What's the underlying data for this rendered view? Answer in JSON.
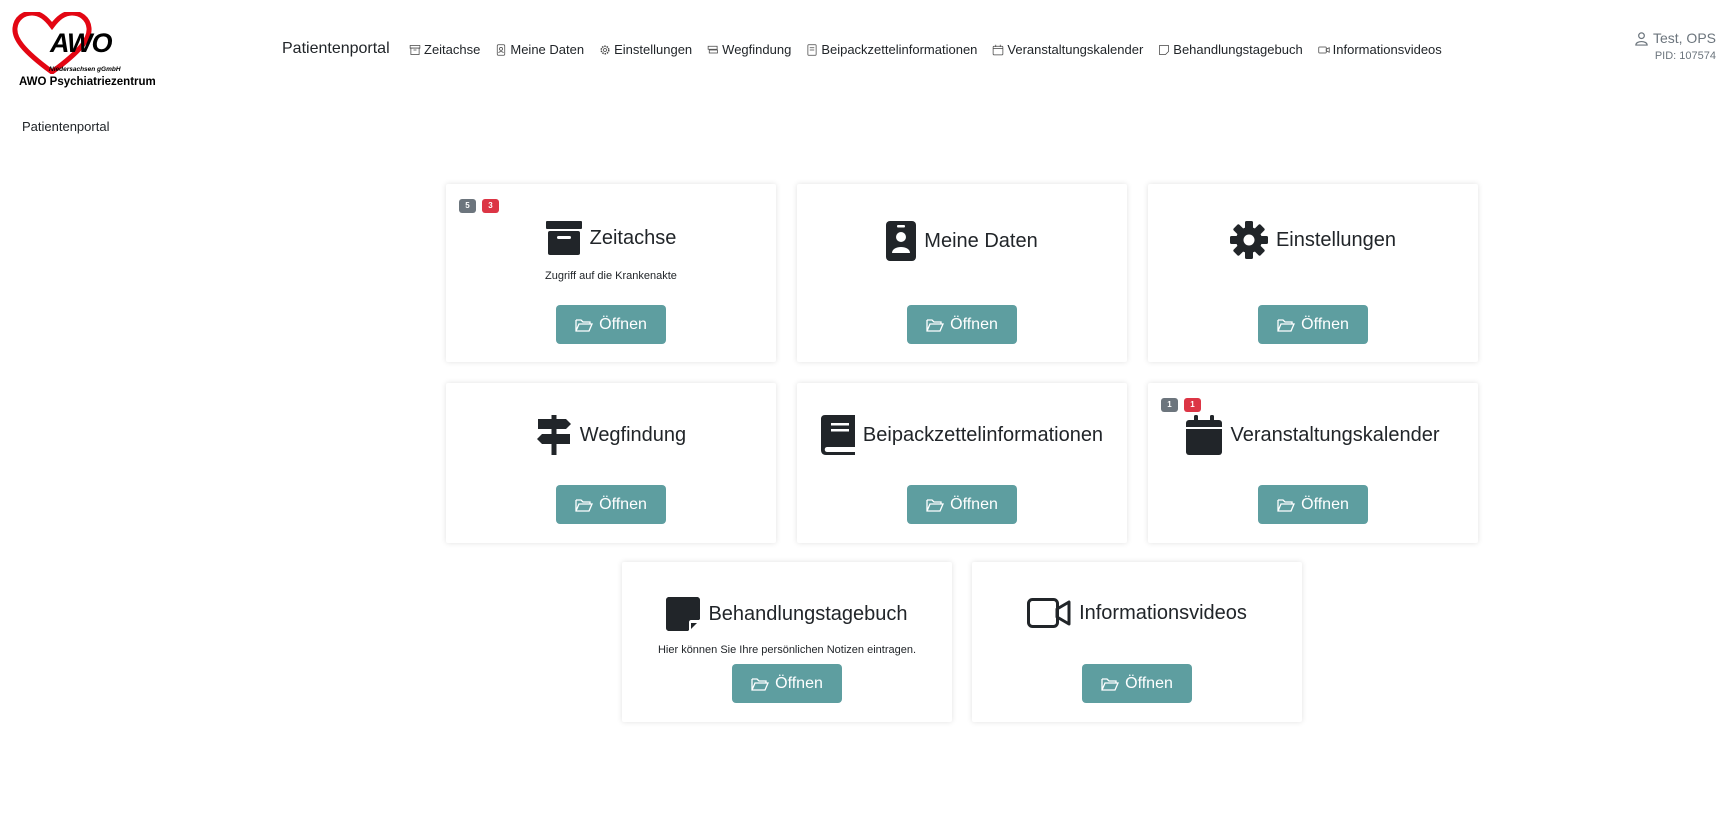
{
  "logo": {
    "word": "AWO",
    "sub_small": "Niedersachsen gGmbH",
    "sub_name": "AWO Psychiatriezentrum",
    "heart_color": "#e30613"
  },
  "header": {
    "brand": "Patientenportal",
    "nav": [
      {
        "label": "Zeitachse",
        "icon": "archive-icon"
      },
      {
        "label": "Meine Daten",
        "icon": "person-badge-icon"
      },
      {
        "label": "Einstellungen",
        "icon": "gear-icon"
      },
      {
        "label": "Wegfindung",
        "icon": "signpost-icon"
      },
      {
        "label": "Beipackzettelinformationen",
        "icon": "book-icon"
      },
      {
        "label": "Veranstaltungskalender",
        "icon": "calendar-icon"
      },
      {
        "label": "Behandlungstagebuch",
        "icon": "sticky-note-icon"
      },
      {
        "label": "Informationsvideos",
        "icon": "video-icon"
      }
    ]
  },
  "user": {
    "name": "Test, OPS",
    "pid": "PID: 107574"
  },
  "breadcrumb": "Patientenportal",
  "colors": {
    "button": "#5e9ea0",
    "badge_gray": "#6c757d",
    "badge_red": "#dc3545"
  },
  "cards": [
    {
      "title": "Zeitachse",
      "desc": "Zugriff auf die Krankenakte",
      "button": "Öffnen",
      "badges": [
        "5",
        "3"
      ],
      "icon": "archive-icon"
    },
    {
      "title": "Meine Daten",
      "desc": "",
      "button": "Öffnen",
      "badges": [],
      "icon": "person-badge-icon"
    },
    {
      "title": "Einstellungen",
      "desc": "",
      "button": "Öffnen",
      "badges": [],
      "icon": "gear-icon"
    },
    {
      "title": "Wegfindung",
      "desc": "",
      "button": "Öffnen",
      "badges": [],
      "icon": "signpost-icon"
    },
    {
      "title": "Beipackzettelinformationen",
      "desc": "",
      "button": "Öffnen",
      "badges": [],
      "icon": "book-icon"
    },
    {
      "title": "Veranstaltungskalender",
      "desc": "",
      "button": "Öffnen",
      "badges": [
        "1",
        "1"
      ],
      "icon": "calendar-icon"
    },
    {
      "title": "Behandlungstagebuch",
      "desc": "Hier können Sie Ihre persönlichen Notizen eintragen.",
      "button": "Öffnen",
      "badges": [],
      "icon": "sticky-note-icon"
    },
    {
      "title": "Informationsvideos",
      "desc": "",
      "button": "Öffnen",
      "badges": [],
      "icon": "video-icon"
    }
  ]
}
